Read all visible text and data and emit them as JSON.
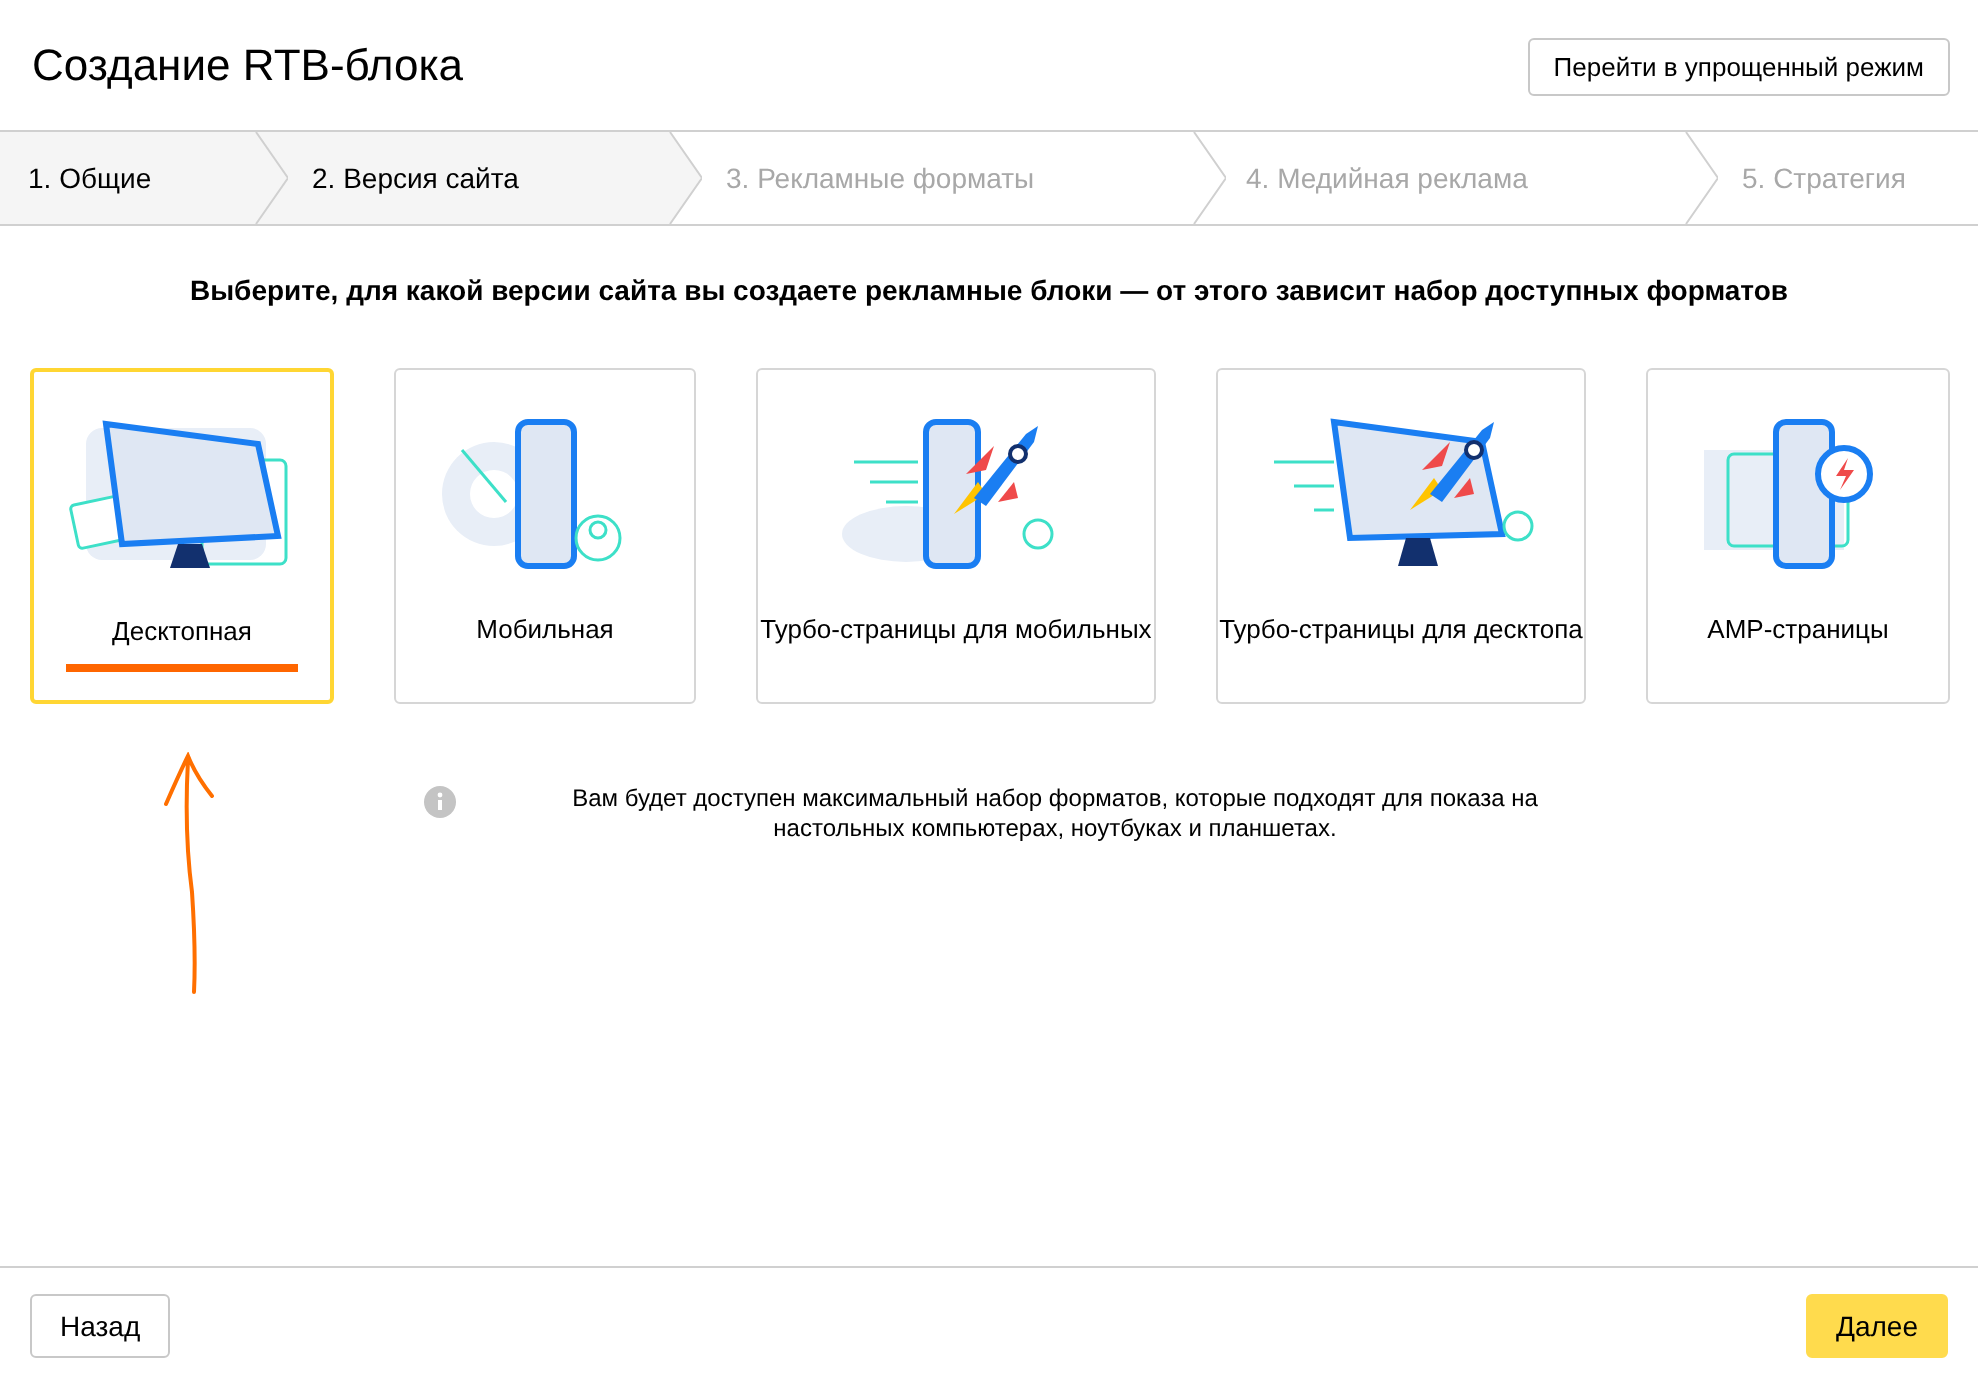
{
  "header": {
    "title": "Создание RTB-блока",
    "mode_button": "Перейти в упрощенный режим"
  },
  "steps": [
    {
      "label": "1. Общие",
      "disabled": false
    },
    {
      "label": "2. Версия сайта",
      "disabled": false
    },
    {
      "label": "3. Рекламные форматы",
      "disabled": true
    },
    {
      "label": "4. Медийная реклама",
      "disabled": true
    },
    {
      "label": "5. Стратегия",
      "disabled": true
    }
  ],
  "prompt": "Выберите, для какой версии сайта вы создаете рекламные блоки — от этого зависит набор доступных форматов",
  "versions": [
    {
      "kind": "desktop",
      "label": "Десктопная",
      "selected": true
    },
    {
      "kind": "mobile",
      "label": "Мобильная",
      "selected": false
    },
    {
      "kind": "turbo-mobile",
      "label": "Турбо-страницы для мобильных",
      "selected": false
    },
    {
      "kind": "turbo-desktop",
      "label": "Турбо-страницы для десктопа",
      "selected": false
    },
    {
      "kind": "amp",
      "label": "AMP-страницы",
      "selected": false
    }
  ],
  "info": "Вам будет доступен максимальный набор форматов, которые подходят для показа на настольных компьютерах, ноутбуках и планшетах.",
  "footer": {
    "back_button": "Назад",
    "next_button": "Далее"
  }
}
